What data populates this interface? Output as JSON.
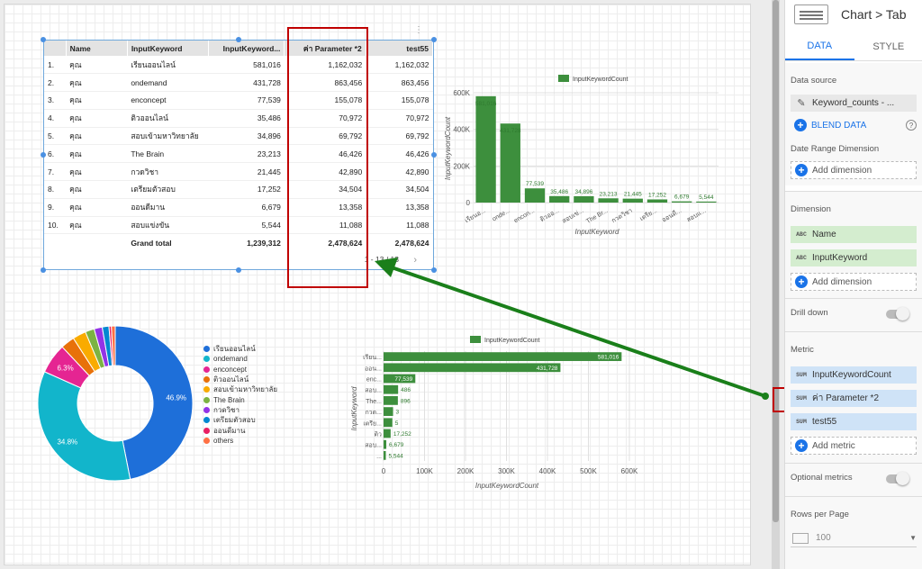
{
  "table": {
    "headers": [
      "",
      "Name",
      "InputKeyword",
      "InputKeyword...",
      "ค่า Parameter *2",
      "test55"
    ],
    "rows": [
      [
        "1.",
        "คุณ",
        "เรียนออนไลน์",
        "581,016",
        "1,162,032",
        "1,162,032"
      ],
      [
        "2.",
        "คุณ",
        "ondemand",
        "431,728",
        "863,456",
        "863,456"
      ],
      [
        "3.",
        "คุณ",
        "enconcept",
        "77,539",
        "155,078",
        "155,078"
      ],
      [
        "4.",
        "คุณ",
        "ติวออนไลน์",
        "35,486",
        "70,972",
        "70,972"
      ],
      [
        "5.",
        "คุณ",
        "สอบเข้ามหาวิทยาลัย",
        "34,896",
        "69,792",
        "69,792"
      ],
      [
        "6.",
        "คุณ",
        "The Brain",
        "23,213",
        "46,426",
        "46,426"
      ],
      [
        "7.",
        "คุณ",
        "กวดวิชา",
        "21,445",
        "42,890",
        "42,890"
      ],
      [
        "8.",
        "คุณ",
        "เตรียมตัวสอบ",
        "17,252",
        "34,504",
        "34,504"
      ],
      [
        "9.",
        "คุณ",
        "ออนดีมาน",
        "6,679",
        "13,358",
        "13,358"
      ],
      [
        "10.",
        "คุณ",
        "สอบแข่งขัน",
        "5,544",
        "11,088",
        "11,088"
      ]
    ],
    "total": [
      "",
      "",
      "Grand total",
      "1,239,312",
      "2,478,624",
      "2,478,624"
    ],
    "pager": "1 - 13 / 13",
    "pager_arrows": "‹ ›"
  },
  "chart_data": [
    {
      "type": "bar",
      "orientation": "vertical",
      "legend": "InputKeywordCount",
      "series_color": "#3d8f3d",
      "categories": [
        "เรียนอ...",
        "onde...",
        "encon...",
        "ติวออ...",
        "สอบเข่...",
        "The Br...",
        "กวดวิชา",
        "เตรีย...",
        "ออนดี...",
        "สอบแ..."
      ],
      "values": [
        581016,
        431728,
        77539,
        35486,
        34896,
        23213,
        21445,
        17252,
        6679,
        5544
      ],
      "labels": [
        "581,016",
        "431,728",
        "77,539",
        "35,486",
        "34,896",
        "23,213",
        "21,445",
        "17,252",
        "6,679",
        "5,544"
      ],
      "yticks": [
        "0",
        "200K",
        "400K",
        "600K"
      ],
      "ylim": [
        0,
        600000
      ],
      "xlabel": "InputKeyword",
      "ylabel": "InputKeywordCount"
    },
    {
      "type": "bar",
      "orientation": "horizontal",
      "legend": "InputKeywordCount",
      "series_color": "#3d8f3d",
      "categories": [
        "เรียน...",
        "ออน...",
        "enc...",
        "สอบ...",
        "The...",
        "กวด...",
        "เตรีย...",
        "ติว",
        "สอบ...",
        "..."
      ],
      "values": [
        581016,
        431728,
        77539,
        35486,
        34896,
        23213,
        21445,
        17252,
        6679,
        5544
      ],
      "labels": [
        "581,016",
        "431,728",
        "77,539",
        "486",
        "896",
        "3",
        "5",
        "17,252",
        "6,679",
        "5,544"
      ],
      "xticks": [
        "0",
        "100K",
        "200K",
        "300K",
        "400K",
        "500K",
        "600K"
      ],
      "xlim": [
        0,
        600000
      ],
      "xlabel": "InputKeywordCount",
      "ylabel": "InputKeyword"
    },
    {
      "type": "pie",
      "donut": true,
      "slices": [
        {
          "name": "เรียนออนไลน์",
          "value": 46.9,
          "color": "#1e6fd9",
          "label": "46.9%"
        },
        {
          "name": "ondemand",
          "value": 34.8,
          "color": "#12b5cb",
          "label": "34.8%"
        },
        {
          "name": "enconcept",
          "value": 6.3,
          "color": "#e52592",
          "label": "6.3%"
        },
        {
          "name": "ติวออนไลน์",
          "value": 2.9,
          "color": "#e8710a",
          "label": ""
        },
        {
          "name": "สอบเข้ามหาวิทยาลัย",
          "value": 2.8,
          "color": "#f9ab00",
          "label": ""
        },
        {
          "name": "The Brain",
          "value": 1.9,
          "color": "#7cb342",
          "label": ""
        },
        {
          "name": "กวดวิชา",
          "value": 1.7,
          "color": "#9334e6",
          "label": ""
        },
        {
          "name": "เตรียมตัวสอบ",
          "value": 1.4,
          "color": "#0288d1",
          "label": ""
        },
        {
          "name": "ออนดีมาน",
          "value": 0.5,
          "color": "#e91e63",
          "label": ""
        },
        {
          "name": "others",
          "value": 0.8,
          "color": "#ff7043",
          "label": ""
        }
      ]
    }
  ],
  "panel": {
    "title": "Chart > Tab",
    "tabs": [
      "DATA",
      "STYLE"
    ],
    "data_source_label": "Data source",
    "data_source_value": "Keyword_counts - ...",
    "blend_data": "BLEND DATA",
    "help_icon": "?",
    "date_range_label": "Date Range Dimension",
    "add_dimension": "Add dimension",
    "dimension_label": "Dimension",
    "dimensions": [
      {
        "tag": "ABC",
        "label": "Name"
      },
      {
        "tag": "ABC",
        "label": "InputKeyword"
      }
    ],
    "add_dimension2": "Add dimension",
    "drill_down": "Drill down",
    "metric_label": "Metric",
    "metrics": [
      {
        "tag": "SUM",
        "label": "InputKeywordCount"
      },
      {
        "tag": "SUM",
        "label": "ค่า Parameter *2"
      },
      {
        "tag": "SUM",
        "label": "test55"
      }
    ],
    "add_metric": "Add metric",
    "optional_metrics": "Optional metrics",
    "rows_per_page_label": "Rows per Page",
    "rows_per_page_value": "100"
  }
}
